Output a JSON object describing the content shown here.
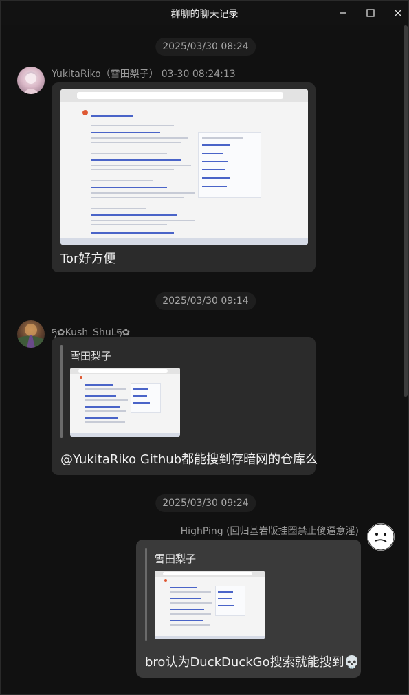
{
  "window": {
    "title": "群聊的聊天记录"
  },
  "messages": [
    {
      "timestamp": "2025/03/30 08:24",
      "sender": "YukitaRiko（雪田梨子）",
      "time": "03-30 08:24:13",
      "text": "Tor好方便"
    },
    {
      "timestamp": "2025/03/30 09:14",
      "sender": "ཧ✿Kush_ShuLཧ✿",
      "quote_name": "雪田梨子",
      "text": "@YukitaRiko Github都能搜到存暗网的仓库么"
    },
    {
      "timestamp": "2025/03/30 09:24",
      "sender": "HighPing (回归基岩版挂圈禁止傻逼意淫)",
      "quote_name": "雪田梨子",
      "text": "bro认为DuckDuckGo搜索就能搜到💀"
    }
  ],
  "colors": {
    "background": "#111111",
    "bubble": "#2b2b2b",
    "bubble_self": "#3a3a3a",
    "timestamp_pill": "#1e1e1e"
  },
  "icons": [
    "minimize-icon",
    "maximize-icon",
    "close-icon"
  ]
}
